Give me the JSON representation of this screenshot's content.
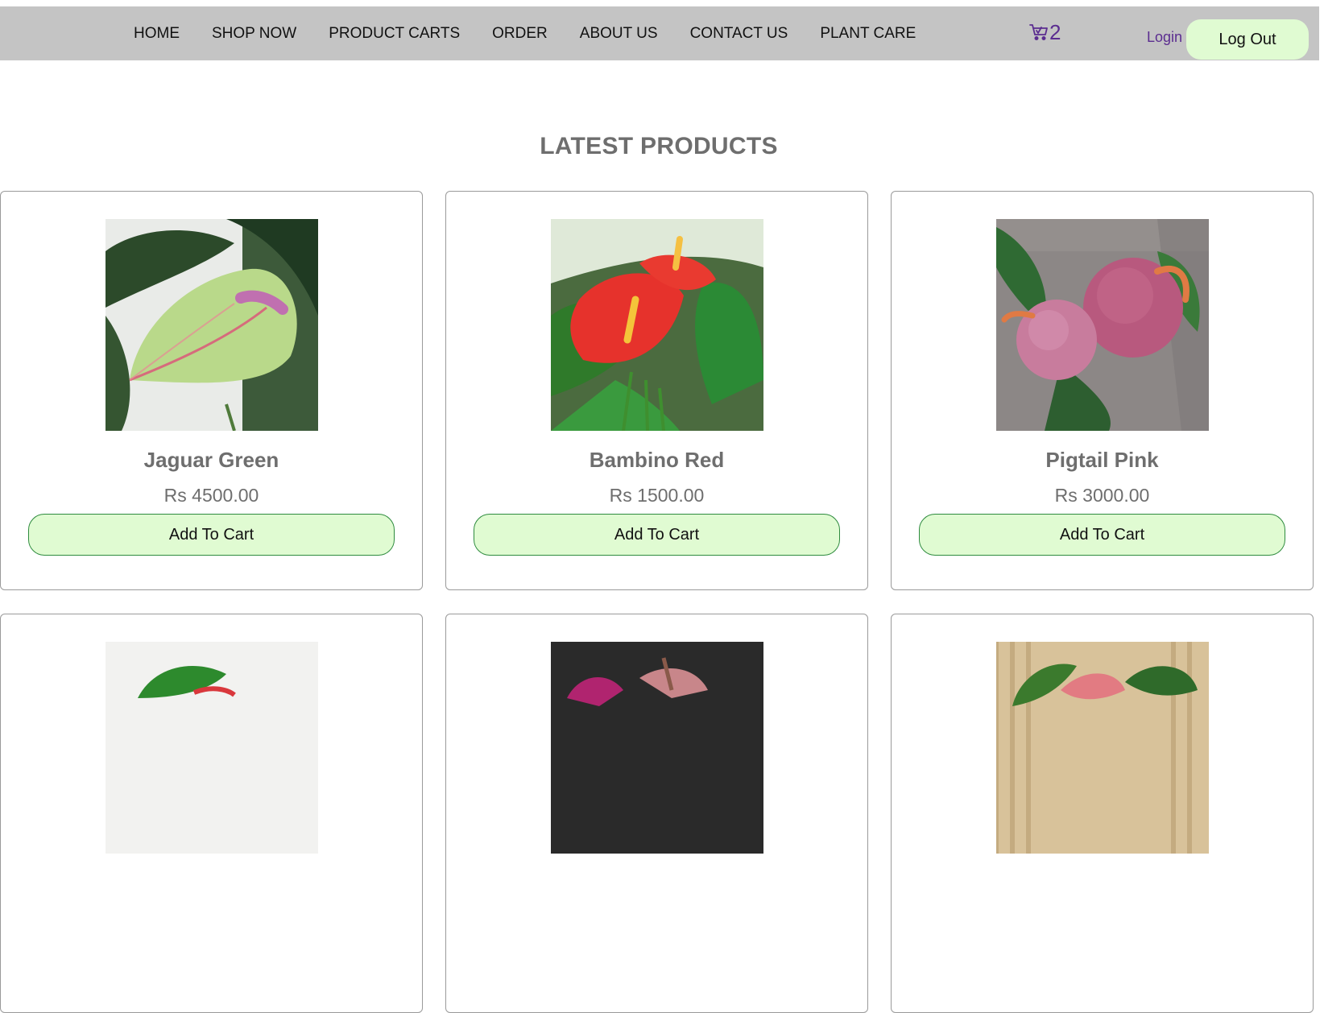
{
  "nav": {
    "items": [
      {
        "label": "HOME"
      },
      {
        "label": "SHOP NOW"
      },
      {
        "label": "PRODUCT CARTS"
      },
      {
        "label": "ORDER"
      },
      {
        "label": "ABOUT US"
      },
      {
        "label": "CONTACT US"
      },
      {
        "label": "PLANT CARE"
      }
    ],
    "cart_count": "2",
    "login_label": "Login",
    "logout_label": "Log Out"
  },
  "section": {
    "title": "LATEST PRODUCTS"
  },
  "products": [
    {
      "name": "Jaguar Green",
      "price": "Rs 4500.00",
      "button": "Add To Cart",
      "image": "green-anthurium-photo"
    },
    {
      "name": "Bambino Red",
      "price": "Rs 1500.00",
      "button": "Add To Cart",
      "image": "red-anthurium-photo"
    },
    {
      "name": "Pigtail Pink",
      "price": "Rs 3000.00",
      "button": "Add To Cart",
      "image": "pink-anthurium-photo"
    },
    {
      "image": "anthurium-photo"
    },
    {
      "image": "purple-anthurium-photo"
    },
    {
      "image": "pink-red-anthurium-photo"
    }
  ],
  "colors": {
    "navbar_bg": "#c4c4c4",
    "button_bg": "#e0fbd2",
    "button_border": "#2e8b3e",
    "link_purple": "#5b2d90",
    "heading_gray": "#6e6e6e"
  }
}
